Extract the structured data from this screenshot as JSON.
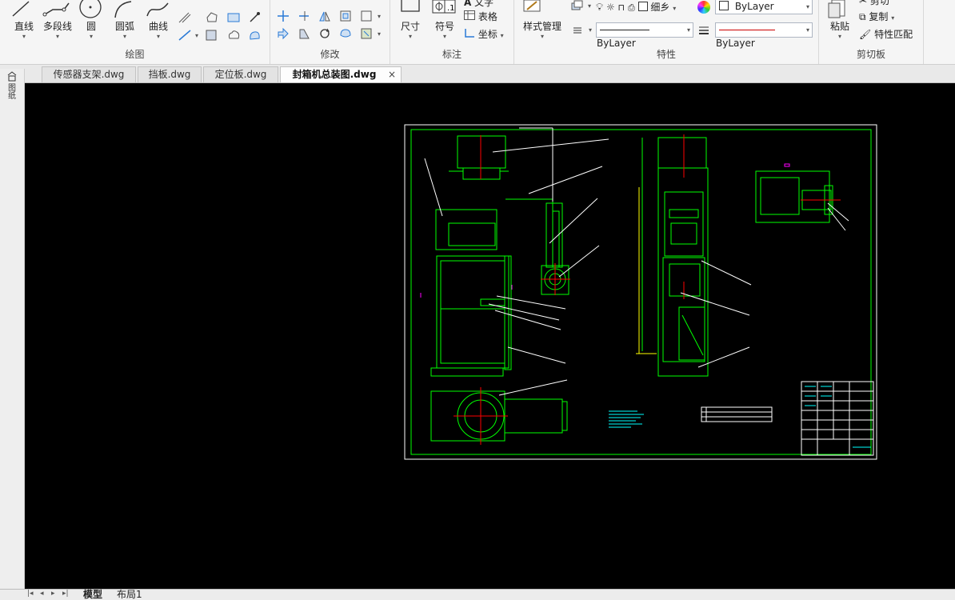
{
  "ribbon": {
    "draw": {
      "title": "绘图",
      "line": "直线",
      "polyline": "多段线",
      "circle": "圆",
      "arc": "圆弧",
      "curve": "曲线"
    },
    "modify": {
      "title": "修改"
    },
    "annotate": {
      "title": "标注",
      "dimension": "尺寸",
      "symbol": "符号",
      "text": "文字",
      "table": "表格",
      "coordinate": "坐标"
    },
    "properties": {
      "title": "特性",
      "style_manager": "样式管理",
      "layer_name": "细乡",
      "color_value": "ByLayer",
      "linetype_value": "ByLayer",
      "lineweight_value": "ByLayer"
    },
    "clipboard": {
      "title": "剪切板",
      "paste": "粘贴",
      "cut": "剪切",
      "copy": "复制",
      "match": "特性匹配"
    }
  },
  "tabs": [
    {
      "label": "传感器支架.dwg"
    },
    {
      "label": "挡板.dwg"
    },
    {
      "label": "定位板.dwg"
    },
    {
      "label": "封箱机总装图.dwg",
      "active": true
    }
  ],
  "tab_close": "×",
  "left_panel": {
    "label": "图纸"
  },
  "layout_tabs": [
    {
      "label": "模型",
      "active": true
    },
    {
      "label": "布局1"
    }
  ],
  "colors": {
    "canvas": "#000000",
    "drawing_green": "#00ff00",
    "drawing_white": "#ffffff",
    "drawing_red": "#ff0000",
    "drawing_cyan": "#00ffff",
    "drawing_magenta": "#ff00ff",
    "drawing_yellow": "#ffff00"
  }
}
